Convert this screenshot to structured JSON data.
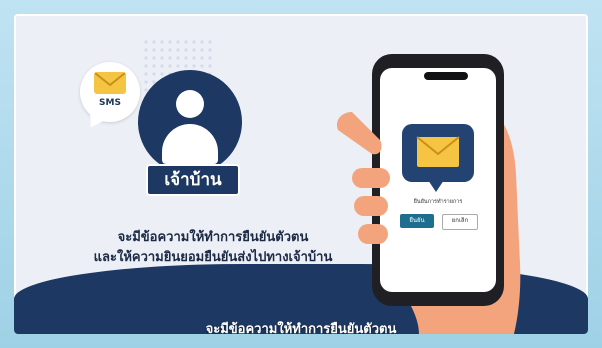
{
  "sms_icon": {
    "label": "SMS",
    "icon": "envelope-icon",
    "envelope_color": "#f6c443"
  },
  "avatar": {
    "icon": "user-icon",
    "label": "เจ้าบ้าน",
    "color": "#1d3863"
  },
  "caption": {
    "line1": "จะมีข้อความให้ทำการยืนยันตัวตน",
    "line2": "และให้ความยินยอมยืนยันส่งไปทางเจ้าบ้าน"
  },
  "phone": {
    "message_icon": "envelope-icon",
    "dialog_title": "ยืนยันการทำรายการ",
    "confirm_label": "ยืนยัน",
    "cancel_label": "ยกเลิก",
    "confirm_color": "#1e6f8f"
  },
  "subtitle": "จะมีข้อความให้ทำการยืนยันตัวตน",
  "colors": {
    "navy": "#1d3863",
    "panel": "#eceff6",
    "frame": "#9fd1e6"
  }
}
